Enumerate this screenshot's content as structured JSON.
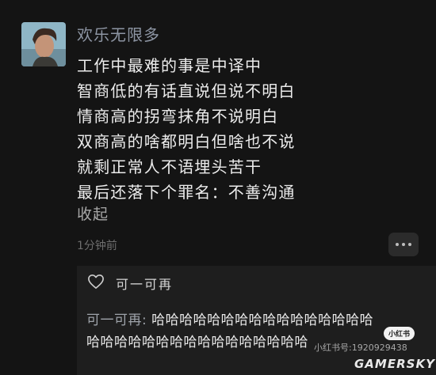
{
  "comment": {
    "username": "欢乐无限多",
    "lines": [
      "工作中最难的事是中译中",
      "智商低的有话直说但说不明白",
      "情商高的拐弯抹角不说明白",
      "双商高的啥都明白但啥也不说",
      "就剩正常人不语埋头苦干",
      "最后还落下个罪名：不善沟通"
    ],
    "collapse_label": "收起",
    "time": "1分钟前"
  },
  "reply": {
    "like_user": "可一可再",
    "author": "可一可再:",
    "content_line1": "哈哈哈哈哈哈哈哈哈哈哈哈哈哈哈哈",
    "content_line2": "哈哈哈哈哈哈哈哈哈哈哈哈哈哈哈哈"
  },
  "watermarks": {
    "badge": "小红书",
    "id": "小红书号:1920929438",
    "brand": "GAMERSKY"
  },
  "icons": {
    "avatar": "user-avatar",
    "like": "heart-outline-icon",
    "more": "more-dots-icon"
  }
}
